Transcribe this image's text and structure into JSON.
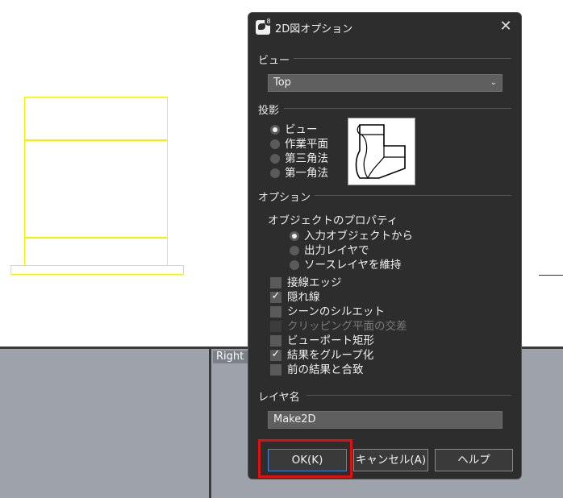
{
  "background": {
    "viewport_label": "Right"
  },
  "dialog": {
    "title": "2D図オプション",
    "app_badge": "8",
    "close_symbol": "✕",
    "view_section": {
      "heading": "ビュー",
      "selected_view": "Top",
      "chevron": "⌄"
    },
    "projection_section": {
      "heading": "投影",
      "options": [
        {
          "label": "ビュー",
          "selected": true
        },
        {
          "label": "作業平面",
          "selected": false
        },
        {
          "label": "第三角法",
          "selected": false
        },
        {
          "label": "第一角法",
          "selected": false
        }
      ]
    },
    "options_section": {
      "heading": "オプション",
      "object_properties": {
        "heading": "オブジェクトのプロパティ",
        "options": [
          {
            "label": "入力オブジェクトから",
            "selected": true
          },
          {
            "label": "出力レイヤで",
            "selected": false
          },
          {
            "label": "ソースレイヤを維持",
            "selected": false
          }
        ]
      },
      "checkboxes": [
        {
          "label": "接線エッジ",
          "checked": false,
          "enabled": true
        },
        {
          "label": "隠れ線",
          "checked": true,
          "enabled": true
        },
        {
          "label": "シーンのシルエット",
          "checked": false,
          "enabled": true
        },
        {
          "label": "クリッピング平面の交差",
          "checked": false,
          "enabled": false
        },
        {
          "label": "ビューポート矩形",
          "checked": false,
          "enabled": true
        },
        {
          "label": "結果をグループ化",
          "checked": true,
          "enabled": true
        },
        {
          "label": "前の結果と合致",
          "checked": false,
          "enabled": true
        }
      ],
      "check_mark": "✓"
    },
    "layer_section": {
      "heading": "レイヤ名",
      "layer_name": "Make2D"
    },
    "buttons": {
      "ok": "OK(K)",
      "cancel": "キャンセル(A)",
      "help": "ヘルプ"
    }
  },
  "colors": {
    "dialog_bg": "#2d2d2d",
    "viewport_gray": "#9ea3ab",
    "drawing_yellow": "#f2f200",
    "highlight_red": "#e01010",
    "ok_border_blue": "#4a86d8"
  }
}
